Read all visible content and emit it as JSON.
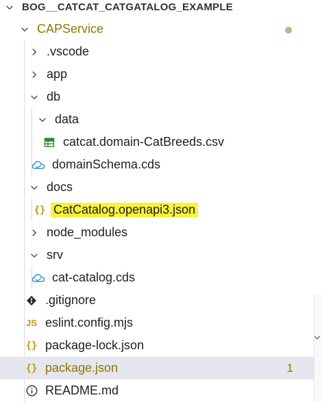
{
  "explorer": {
    "root_label": "BOG__CATCAT_CATGATALOG_EXAMPLE",
    "project_label": "CAPService",
    "items": [
      {
        "label": ".vscode",
        "icon": "chevron-right-icon"
      },
      {
        "label": "app",
        "icon": "chevron-right-icon"
      },
      {
        "label": "db",
        "icon": "chevron-down-icon"
      },
      {
        "label": "data",
        "icon": "chevron-down-icon"
      },
      {
        "label": "catcat.domain-CatBreeds.csv",
        "icon": "csv-file-icon"
      },
      {
        "label": "domainSchema.cds",
        "icon": "cds-file-icon"
      },
      {
        "label": "docs",
        "icon": "chevron-down-icon"
      },
      {
        "label": "CatCatalog.openapi3.json",
        "icon": "json-file-icon"
      },
      {
        "label": "node_modules",
        "icon": "chevron-right-icon"
      },
      {
        "label": "srv",
        "icon": "chevron-down-icon"
      },
      {
        "label": "cat-catalog.cds",
        "icon": "cds-file-icon"
      },
      {
        "label": ".gitignore",
        "icon": "git-icon"
      },
      {
        "label": "eslint.config.mjs",
        "icon": "js-file-icon"
      },
      {
        "label": "package-lock.json",
        "icon": "json-file-icon"
      },
      {
        "label": "package.json",
        "icon": "json-file-icon",
        "badge": "1"
      },
      {
        "label": "README.md",
        "icon": "info-icon"
      }
    ],
    "json_icon_glyph": "{}",
    "js_icon_glyph": "JS",
    "colors": {
      "highlight": "#f7f23a",
      "selected_row": "#e6e6ee",
      "modified_badge": "#8a7a00",
      "cds_icon": "#3b8fd4",
      "csv_icon": "#2e8b2e"
    }
  }
}
